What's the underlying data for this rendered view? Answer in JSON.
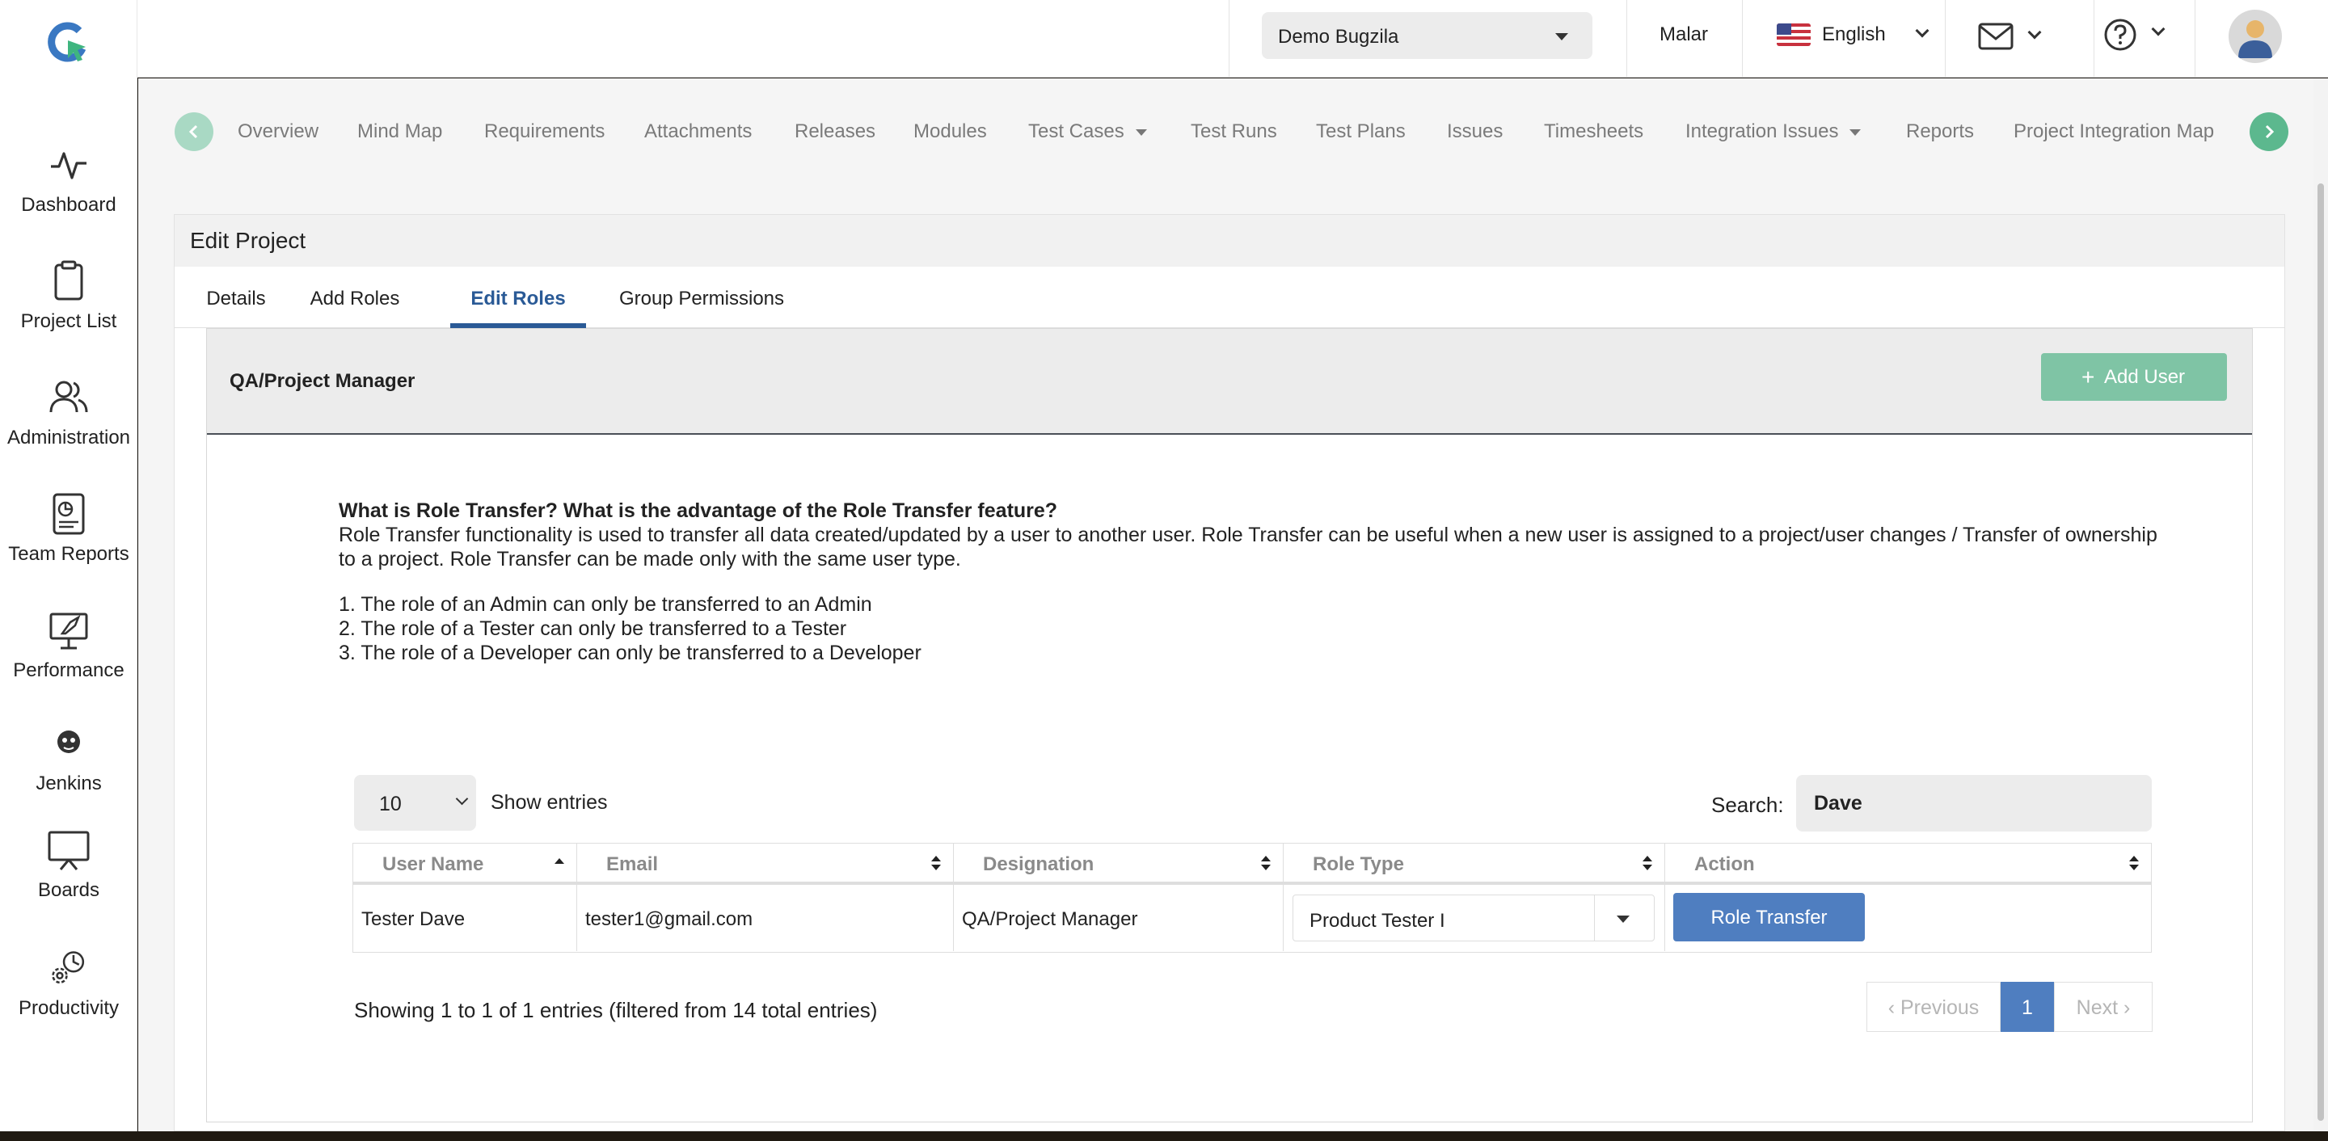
{
  "header": {
    "project_selector": "Demo Bugzila",
    "user_name": "Malar",
    "language": "English"
  },
  "sidebar": {
    "items": [
      {
        "label": "Dashboard",
        "icon": "activity-icon"
      },
      {
        "label": "Project List",
        "icon": "clipboard-icon"
      },
      {
        "label": "Administration",
        "icon": "users-icon"
      },
      {
        "label": "Team Reports",
        "icon": "report-icon"
      },
      {
        "label": "Performance",
        "icon": "rocket-icon"
      },
      {
        "label": "Jenkins",
        "icon": "jenkins-icon"
      },
      {
        "label": "Boards",
        "icon": "presentation-board-icon"
      },
      {
        "label": "Productivity",
        "icon": "gears-icon"
      }
    ]
  },
  "module_nav": {
    "items": [
      {
        "label": "Overview"
      },
      {
        "label": "Mind Map"
      },
      {
        "label": "Requirements"
      },
      {
        "label": "Attachments"
      },
      {
        "label": "Releases"
      },
      {
        "label": "Modules"
      },
      {
        "label": "Test Cases"
      },
      {
        "label": "Test Runs"
      },
      {
        "label": "Test Plans"
      },
      {
        "label": "Issues"
      },
      {
        "label": "Timesheets"
      },
      {
        "label": "Integration Issues"
      },
      {
        "label": "Reports"
      },
      {
        "label": "Project Integration Map"
      }
    ]
  },
  "page": {
    "title": "Edit Project",
    "tabs": [
      {
        "label": "Details"
      },
      {
        "label": "Add Roles"
      },
      {
        "label": "Edit Roles"
      },
      {
        "label": "Group Permissions"
      }
    ],
    "active_tab": "Edit Roles"
  },
  "role_section": {
    "role_name": "QA/Project Manager",
    "add_user_label": "Add User"
  },
  "info": {
    "question": "What is Role Transfer? What is the advantage of the Role Transfer feature?",
    "description": "Role Transfer functionality is used to transfer all data created/updated by a user to another user. Role Transfer can be useful when a new user is assigned to a project/user changes / Transfer of ownership to a project. Role Transfer can be made only with the same user type.",
    "rules": [
      "1. The role of an Admin can only be transferred to an Admin",
      "2. The role of a Tester can only be transferred to a Tester",
      "3. The role of a Developer can only be transferred to a Developer"
    ]
  },
  "table": {
    "length_value": "10",
    "show_entries_label": "Show entries",
    "search_label": "Search:",
    "search_value": "Dave",
    "columns": [
      "User Name",
      "Email",
      "Designation",
      "Role Type",
      "Action"
    ],
    "rows": [
      {
        "user_name": "Tester Dave",
        "email": "tester1@gmail.com",
        "designation": "QA/Project Manager",
        "role_type": "Product Tester I",
        "action_label": "Role Transfer"
      }
    ],
    "info_text": "Showing 1 to 1 of 1 entries (filtered from 14 total entries)",
    "pagination": {
      "previous": "Previous",
      "current": "1",
      "next": "Next"
    }
  },
  "colors": {
    "accent_green": "#5cb88e",
    "add_user_green": "#7fc4a5",
    "primary_blue": "#4f7ec0",
    "tab_active": "#2a5a96"
  }
}
